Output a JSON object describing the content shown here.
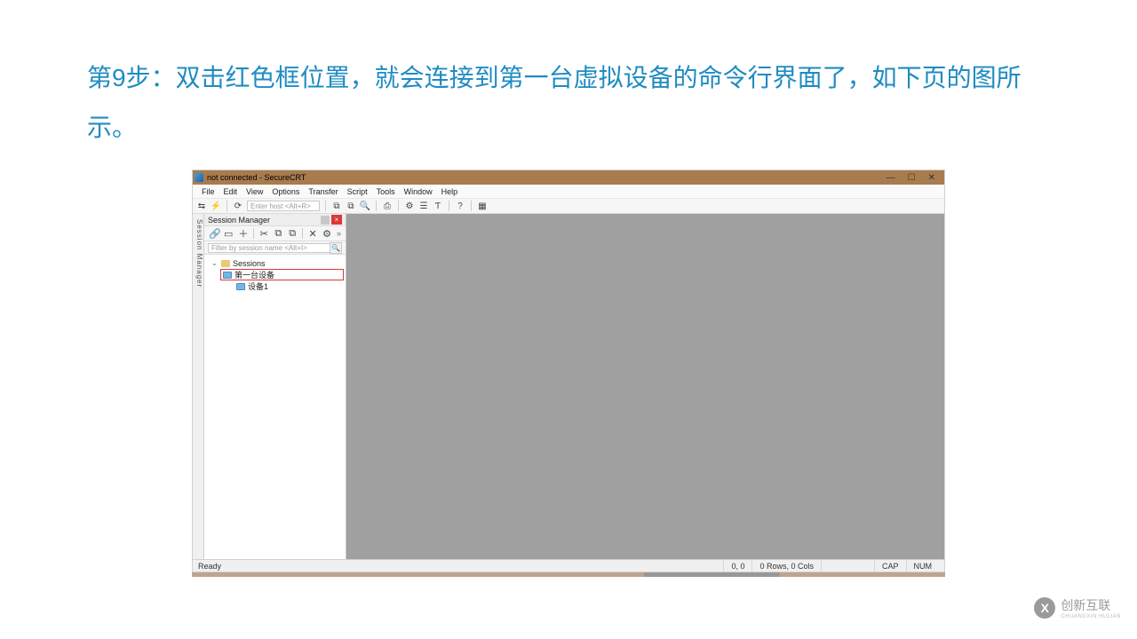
{
  "instruction_text": "第9步：双击红色框位置，就会连接到第一台虚拟设备的命令行界面了，如下页的图所示。",
  "window": {
    "title": "not connected - SecureCRT",
    "controls": {
      "min": "—",
      "max": "☐",
      "close": "✕"
    }
  },
  "menu": {
    "items": [
      "File",
      "Edit",
      "View",
      "Options",
      "Transfer",
      "Script",
      "Tools",
      "Window",
      "Help"
    ]
  },
  "main_toolbar": {
    "host_placeholder": "Enter host <Alt+R>"
  },
  "session_panel": {
    "title": "Session Manager",
    "filter_placeholder": "Filter by session name <Alt+I>",
    "root_label": "Sessions",
    "items": [
      {
        "label": "第一台设备",
        "highlighted": true
      },
      {
        "label": "设备1",
        "highlighted": false
      }
    ]
  },
  "side_tab_label": "Session Manager",
  "status": {
    "left": "Ready",
    "pos": "0, 0",
    "rows_cols": "0 Rows, 0 Cols",
    "caps": "CAP",
    "num": "NUM"
  },
  "logo": {
    "text": "创新互联",
    "sub": "CHUANGXIN HULIAN"
  }
}
